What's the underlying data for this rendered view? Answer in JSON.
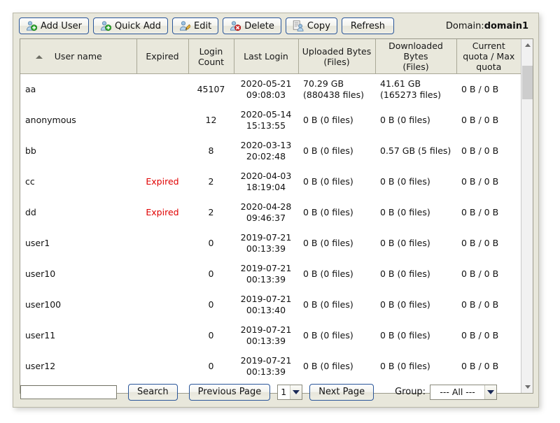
{
  "toolbar": {
    "buttons": [
      {
        "label": "Add User",
        "icon": "user-add-icon"
      },
      {
        "label": "Quick Add",
        "icon": "user-add-icon"
      },
      {
        "label": "Edit",
        "icon": "user-edit-icon"
      },
      {
        "label": "Delete",
        "icon": "user-delete-icon"
      },
      {
        "label": "Copy",
        "icon": "user-copy-icon"
      },
      {
        "label": "Refresh",
        "icon": "none"
      }
    ],
    "domain_prefix": "Domain:",
    "domain_value": "domain1"
  },
  "grid": {
    "sort_column": "User name",
    "sort_direction": "ascending",
    "columns": [
      "User name",
      "Expired",
      "Login Count",
      "Last Login",
      "Uploaded Bytes (Files)",
      "Downloaded Bytes (Files)",
      "Current quota / Max quota"
    ],
    "headers": [
      {
        "line1": "User name",
        "line2": ""
      },
      {
        "line1": "Expired",
        "line2": ""
      },
      {
        "line1": "Login",
        "line2": "Count"
      },
      {
        "line1": "Last Login",
        "line2": ""
      },
      {
        "line1": "Uploaded Bytes",
        "line2": "(Files)"
      },
      {
        "line1": "Downloaded Bytes",
        "line2": "(Files)"
      },
      {
        "line1": "Current quota / Max",
        "line2": "quota"
      }
    ],
    "rows": [
      {
        "user": "aa",
        "expired": "",
        "count": "45107",
        "last_login_date": "2020-05-21",
        "last_login_time": "09:08:03",
        "uploaded_size": "70.29 GB",
        "uploaded_files": "(880438 files)",
        "downloaded_size": "41.61 GB",
        "downloaded_files": "(165273 files)",
        "quota": "0 B / 0 B"
      },
      {
        "user": "anonymous",
        "expired": "",
        "count": "12",
        "last_login_date": "2020-05-14",
        "last_login_time": "15:13:55",
        "uploaded_size": "0 B (0 files)",
        "uploaded_files": "",
        "downloaded_size": "0 B (0 files)",
        "downloaded_files": "",
        "quota": "0 B / 0 B"
      },
      {
        "user": "bb",
        "expired": "",
        "count": "8",
        "last_login_date": "2020-03-13",
        "last_login_time": "20:02:48",
        "uploaded_size": "0 B (0 files)",
        "uploaded_files": "",
        "downloaded_size": "0.57 GB (5 files)",
        "downloaded_files": "",
        "quota": "0 B / 0 B"
      },
      {
        "user": "cc",
        "expired": "Expired",
        "count": "2",
        "last_login_date": "2020-04-03",
        "last_login_time": "18:19:04",
        "uploaded_size": "0 B (0 files)",
        "uploaded_files": "",
        "downloaded_size": "0 B (0 files)",
        "downloaded_files": "",
        "quota": "0 B / 0 B"
      },
      {
        "user": "dd",
        "expired": "Expired",
        "count": "2",
        "last_login_date": "2020-04-28",
        "last_login_time": "09:46:37",
        "uploaded_size": "0 B (0 files)",
        "uploaded_files": "",
        "downloaded_size": "0 B (0 files)",
        "downloaded_files": "",
        "quota": "0 B / 0 B"
      },
      {
        "user": "user1",
        "expired": "",
        "count": "0",
        "last_login_date": "2019-07-21",
        "last_login_time": "00:13:39",
        "uploaded_size": "0 B (0 files)",
        "uploaded_files": "",
        "downloaded_size": "0 B (0 files)",
        "downloaded_files": "",
        "quota": "0 B / 0 B"
      },
      {
        "user": "user10",
        "expired": "",
        "count": "0",
        "last_login_date": "2019-07-21",
        "last_login_time": "00:13:39",
        "uploaded_size": "0 B (0 files)",
        "uploaded_files": "",
        "downloaded_size": "0 B (0 files)",
        "downloaded_files": "",
        "quota": "0 B / 0 B"
      },
      {
        "user": "user100",
        "expired": "",
        "count": "0",
        "last_login_date": "2019-07-21",
        "last_login_time": "00:13:40",
        "uploaded_size": "0 B (0 files)",
        "uploaded_files": "",
        "downloaded_size": "0 B (0 files)",
        "downloaded_files": "",
        "quota": "0 B / 0 B"
      },
      {
        "user": "user11",
        "expired": "",
        "count": "0",
        "last_login_date": "2019-07-21",
        "last_login_time": "00:13:39",
        "uploaded_size": "0 B (0 files)",
        "uploaded_files": "",
        "downloaded_size": "0 B (0 files)",
        "downloaded_files": "",
        "quota": "0 B / 0 B"
      },
      {
        "user": "user12",
        "expired": "",
        "count": "0",
        "last_login_date": "2019-07-21",
        "last_login_time": "00:13:39",
        "uploaded_size": "0 B (0 files)",
        "uploaded_files": "",
        "downloaded_size": "0 B (0 files)",
        "downloaded_files": "",
        "quota": "0 B / 0 B"
      }
    ]
  },
  "footer": {
    "search_value": "",
    "search_placeholder": "",
    "search_label": "Search",
    "previous_page_label": "Previous Page",
    "next_page_label": "Next Page",
    "page_value": "1",
    "group_label": "Group:",
    "group_value": "--- All ---"
  },
  "colors": {
    "panel_bg": "#e8e7db",
    "header_bg": "#e9e8dc",
    "button_border": "#2a5699",
    "expired_text": "#e00000",
    "grid_bg": "#ffffff"
  }
}
